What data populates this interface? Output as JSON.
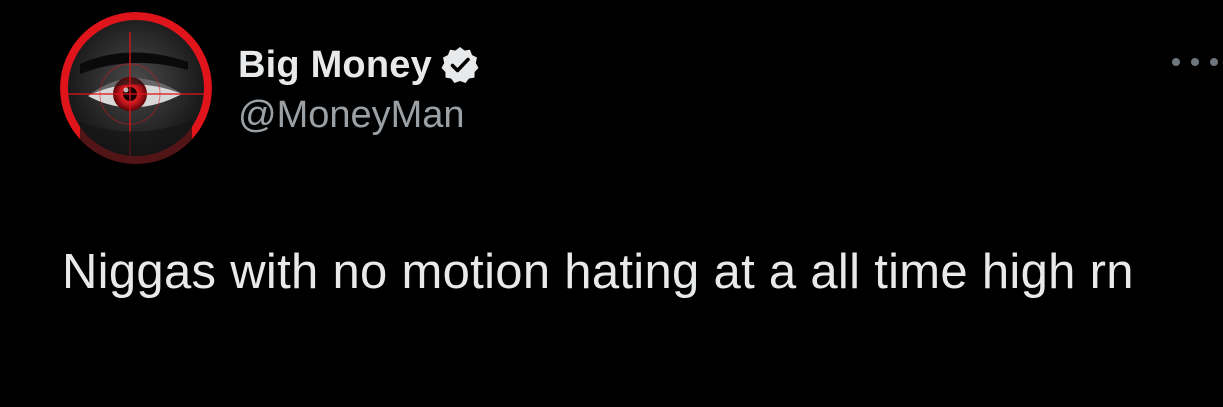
{
  "tweet": {
    "author": {
      "display_name": "Big Money",
      "handle": "@MoneyMan",
      "verified": true,
      "avatar_icon": "red-eye-crosshair-avatar"
    },
    "text": "Niggas with no motion hating at a all time high rn",
    "more_icon": "more-options-icon"
  },
  "colors": {
    "background": "#000000",
    "text_primary": "#e7e9ea",
    "text_secondary": "#9ba0a5",
    "avatar_ring": "#e0141b",
    "verified_badge": "#e7e9ea"
  }
}
